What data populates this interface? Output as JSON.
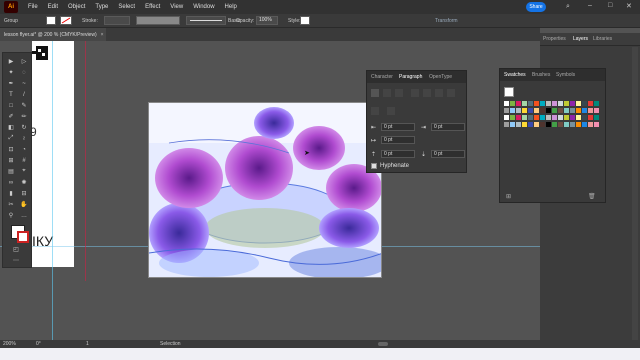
{
  "app": {
    "logo": "Ai"
  },
  "menu": [
    "File",
    "Edit",
    "Object",
    "Type",
    "Select",
    "Effect",
    "View",
    "Window",
    "Help"
  ],
  "share_label": "Share",
  "control_bar": {
    "selection": "Group",
    "stroke_label": "Stroke:",
    "stroke_style": "Basic",
    "opacity_label": "Opacity:",
    "opacity_value": "100%",
    "style_label": "Style:",
    "transform_label": "Transform"
  },
  "document_tab": {
    "label": "lesson flyer.ai* @ 200 % (CMYK/Preview)"
  },
  "right_tabs": [
    "Properties",
    "Layers",
    "Libraries"
  ],
  "paragraph_panel": {
    "tabs": [
      "Character",
      "Paragraph",
      "OpenType"
    ],
    "indent_left": "0 pt",
    "indent_right": "0 pt",
    "first_line": "0 pt",
    "space_before": "0 pt",
    "space_after": "0 pt",
    "space_after2": "0 pt",
    "hyphenate_label": "Hyphenate"
  },
  "swatches_panel": {
    "tabs": [
      "Swatches",
      "Brushes",
      "Symbols"
    ]
  },
  "artboard_text": {
    "left_char": "9",
    "cyrillic": "ІКУ"
  },
  "status": {
    "zoom": "200%",
    "angle": "0°",
    "page": "1",
    "tool": "Selection"
  },
  "icons": [
    "select-tool-icon",
    "direct-select-icon",
    "pen-icon",
    "type-icon",
    "line-icon",
    "rect-icon",
    "brush-icon",
    "pencil-icon",
    "eraser-icon",
    "rotate-icon",
    "scale-icon",
    "width-icon",
    "shape-builder-icon",
    "gradient-icon",
    "eyedropper-icon",
    "blend-icon",
    "symbol-sprayer-icon",
    "graph-icon",
    "artboard-icon",
    "slice-icon",
    "hand-icon",
    "zoom-icon"
  ]
}
